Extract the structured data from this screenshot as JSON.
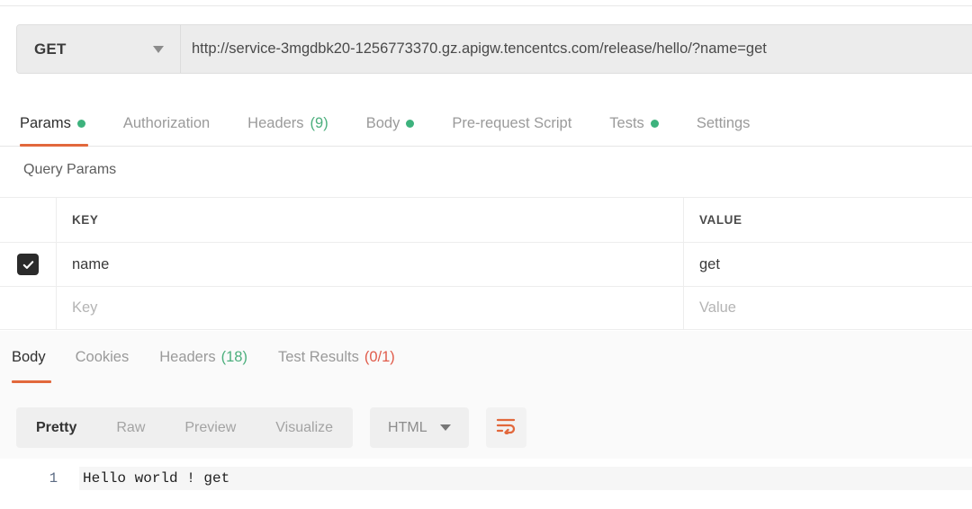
{
  "request": {
    "method": "GET",
    "url": "http://service-3mgdbk20-1256773370.gz.apigw.tencentcs.com/release/hello/?name=get",
    "tabs": [
      {
        "label": "Params",
        "dot": true,
        "count": "",
        "active": true
      },
      {
        "label": "Authorization",
        "dot": false,
        "count": "",
        "active": false
      },
      {
        "label": "Headers",
        "dot": false,
        "count": "(9)",
        "active": false
      },
      {
        "label": "Body",
        "dot": true,
        "count": "",
        "active": false
      },
      {
        "label": "Pre-request Script",
        "dot": false,
        "count": "",
        "active": false
      },
      {
        "label": "Tests",
        "dot": true,
        "count": "",
        "active": false
      },
      {
        "label": "Settings",
        "dot": false,
        "count": "",
        "active": false
      }
    ]
  },
  "query_params": {
    "section_title": "Query Params",
    "columns": {
      "key": "KEY",
      "value": "VALUE"
    },
    "rows": [
      {
        "checked": true,
        "key": "name",
        "value": "get"
      }
    ],
    "new_row": {
      "key_placeholder": "Key",
      "value_placeholder": "Value"
    }
  },
  "response": {
    "tabs": [
      {
        "label": "Body",
        "count": "",
        "active": true
      },
      {
        "label": "Cookies",
        "count": "",
        "active": false
      },
      {
        "label": "Headers",
        "count": "(18)",
        "active": false
      },
      {
        "label": "Test Results",
        "count": "(0/1)",
        "active": false
      }
    ],
    "view_modes": [
      {
        "label": "Pretty",
        "active": true
      },
      {
        "label": "Raw",
        "active": false
      },
      {
        "label": "Preview",
        "active": false
      },
      {
        "label": "Visualize",
        "active": false
      }
    ],
    "format": "HTML",
    "wrap_button": "word-wrap-icon",
    "body": {
      "line_number": "1",
      "text": "Hello world ! get"
    }
  },
  "colors": {
    "accent": "#e2683c",
    "dot_green": "#3db27d",
    "count_green": "#4caf7d",
    "count_red": "#e05b4a"
  }
}
